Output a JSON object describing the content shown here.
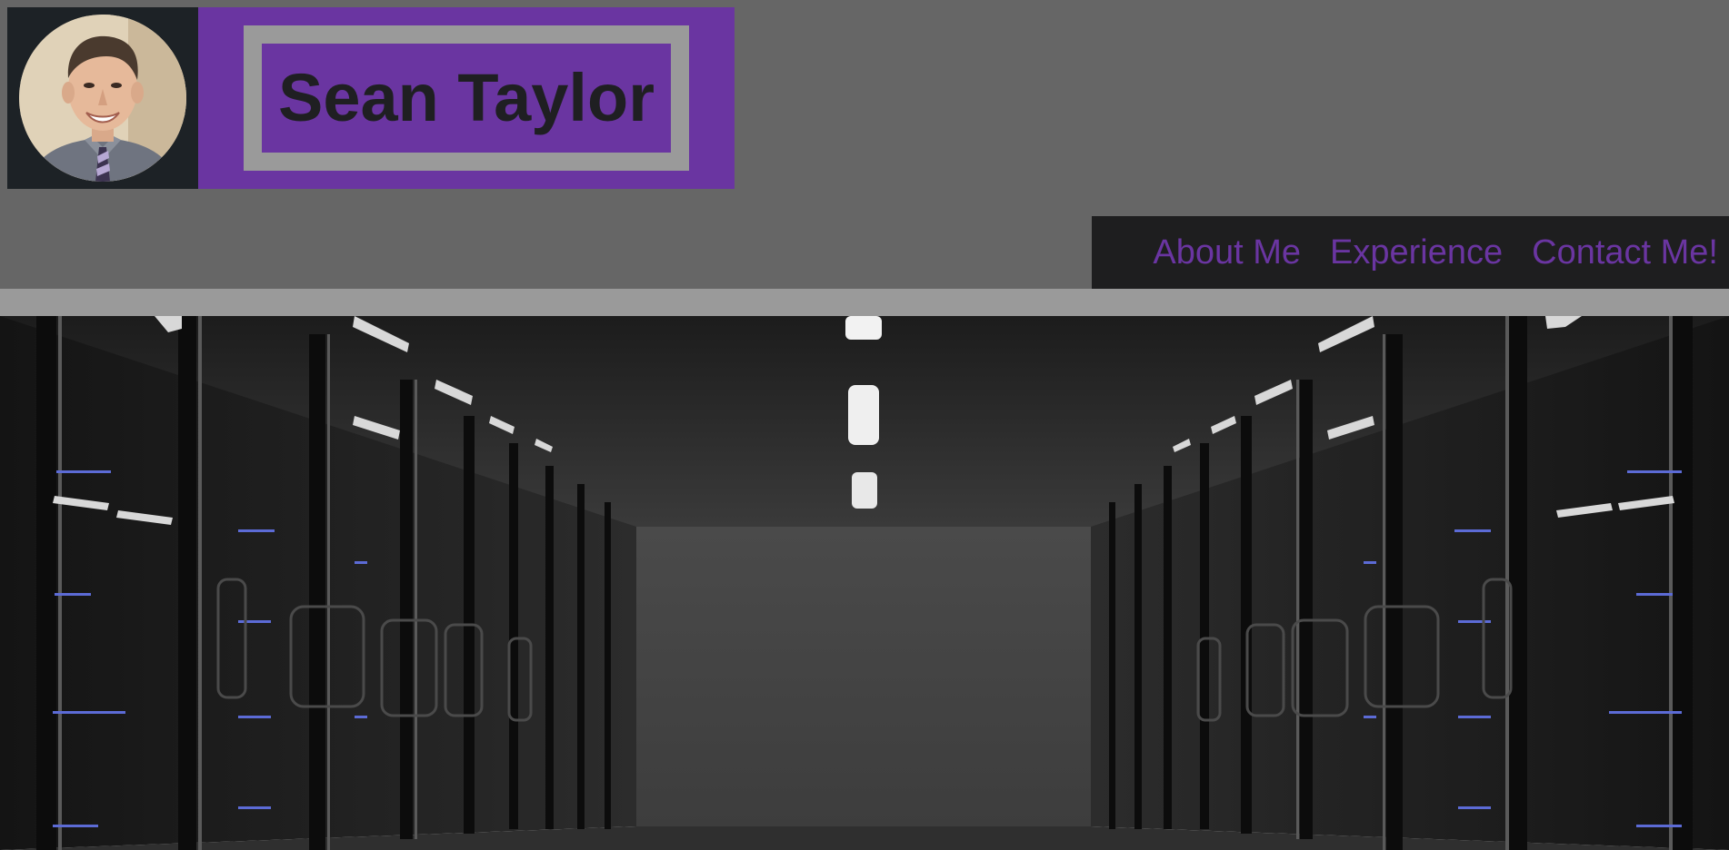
{
  "header": {
    "site_title": "Sean Taylor",
    "avatar": {
      "icon": "profile-photo",
      "alt": "Sean Taylor"
    }
  },
  "nav": {
    "items": [
      {
        "label": "About Me"
      },
      {
        "label": "Experience"
      },
      {
        "label": "Contact Me!"
      }
    ]
  },
  "hero": {
    "icon": "server-room-photo"
  },
  "colors": {
    "accent": "#6a35a1",
    "header_bg": "#666666",
    "frame": "#9a9a9a",
    "nav_bg": "#1e1e1f",
    "title_text": "#1f1f22"
  }
}
